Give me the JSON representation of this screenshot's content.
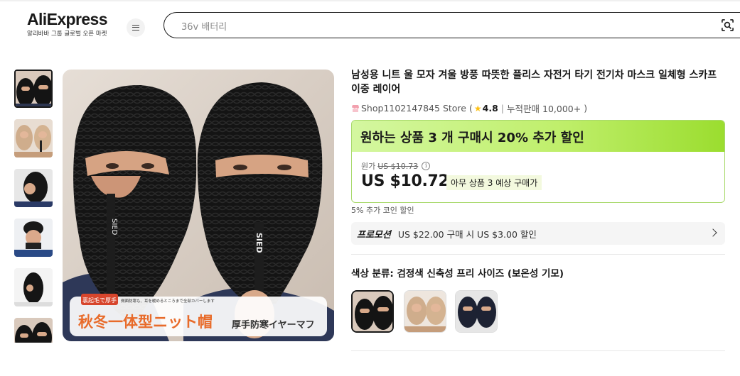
{
  "header": {
    "logo_text": "AliExpress",
    "logo_subtitle": "알리바바 그룹 글로벌 오픈 마켓",
    "search_placeholder": "36v 배터리",
    "icons": [
      "menu-icon",
      "image-search-icon"
    ]
  },
  "gallery": {
    "thumbnail_count": 6,
    "selected_index": 0,
    "banner_tag": "裏起毛で厚手",
    "banner_small": "側面防寒も、耳を暖めるところまで全部カバーします",
    "banner_main": "秋冬一体型ニット帽",
    "banner_right": "厚手防寒イヤーマフ",
    "zipper_text": "SIED"
  },
  "product": {
    "title": "남성용 니트 울 모자 겨울 방풍 따뜻한 플리스 자전거 타기 전기차 마스크 일체형 스카프 이중 레이어",
    "store_name": "Shop1102147845 Store",
    "rating": "4.8",
    "sold": "누적판매 10,000+"
  },
  "deal": {
    "headline": "원하는 상품 3 개 구매시 20% 추가 할인",
    "original_label": "원가",
    "original_price": "US $10.73",
    "price": "US $10.72",
    "price_note": "아무 상품 3 예상 구매가"
  },
  "coin_text": "5% 추가 코인 할인",
  "promo": {
    "label": "프로모션",
    "text": "US $22.00 구매 시 US $3.00 할인"
  },
  "variant": {
    "label": "색상 분류: 검정색 신축성 프리 사이즈 (보온성 기모)",
    "swatch_count": 3,
    "selected_index": 0
  },
  "colors": {
    "accent_green": "#c0ef6c",
    "text_primary": "#191919",
    "star": "#fdc012"
  }
}
